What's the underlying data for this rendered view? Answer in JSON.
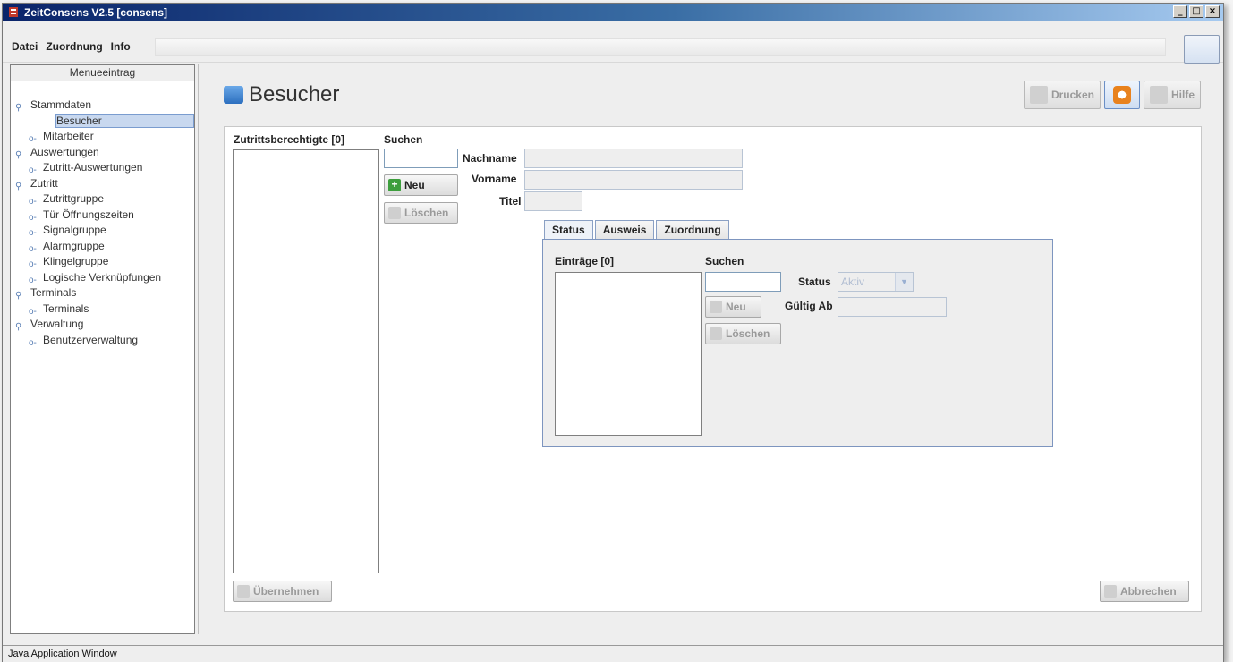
{
  "window": {
    "title": "ZeitConsens V2.5 [consens]",
    "controls": {
      "minimize": "_",
      "maximize": "□",
      "close": "×"
    }
  },
  "menu": {
    "items": [
      "Datei",
      "Zuordnung",
      "Info"
    ]
  },
  "sidebar": {
    "header": "Menueeintrag",
    "items": [
      {
        "label": "Stammdaten"
      },
      {
        "label": "Besucher"
      },
      {
        "label": "Mitarbeiter"
      },
      {
        "label": "Auswertungen"
      },
      {
        "label": "Zutritt-Auswertungen"
      },
      {
        "label": "Zutritt"
      },
      {
        "label": "Zutrittgruppe"
      },
      {
        "label": "Tür Öffnungszeiten"
      },
      {
        "label": "Signalgruppe"
      },
      {
        "label": "Alarmgruppe"
      },
      {
        "label": "Klingelgruppe"
      },
      {
        "label": "Logische Verknüpfungen"
      },
      {
        "label": "Terminals"
      },
      {
        "label": "Terminals"
      },
      {
        "label": "Verwaltung"
      },
      {
        "label": "Benutzerverwaltung"
      }
    ]
  },
  "page": {
    "title": "Besucher"
  },
  "toolbar": {
    "print_label": "Drucken",
    "help_label": "Hilfe"
  },
  "form": {
    "list_label": "Zutrittsberechtigte [0]",
    "search_label": "Suchen",
    "search_value": "",
    "new_label": "Neu",
    "delete_label": "Löschen",
    "lastname_label": "Nachname",
    "firstname_label": "Vorname",
    "title_label": "Titel",
    "apply_label": "Übernehmen",
    "cancel_label": "Abbrechen"
  },
  "tabs": {
    "items": [
      "Status",
      "Ausweis",
      "Zuordnung"
    ],
    "active": "Status"
  },
  "status_tab": {
    "entries_label": "Einträge [0]",
    "search_label": "Suchen",
    "new_label": "Neu",
    "delete_label": "Löschen",
    "status_label": "Status",
    "status_value": "Aktiv",
    "valid_from_label": "Gültig Ab"
  },
  "statusbar": {
    "text": "Java Application Window"
  }
}
